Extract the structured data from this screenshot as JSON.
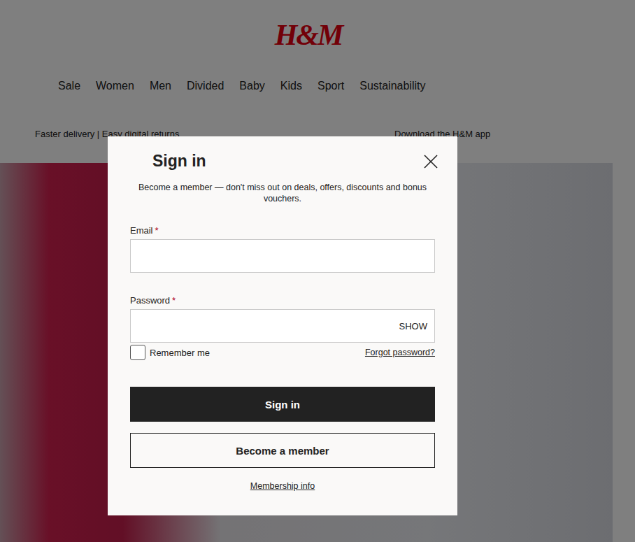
{
  "logo": "H&M",
  "nav": [
    "Sale",
    "Women",
    "Men",
    "Divided",
    "Baby",
    "Kids",
    "Sport",
    "Sustainability"
  ],
  "banner": {
    "left": "Faster delivery | Easy digital returns",
    "right": "Download the H&M app"
  },
  "modal": {
    "title": "Sign in",
    "subtitle": "Become a member — don't miss out on deals, offers, discounts and bonus vouchers.",
    "fields": [
      {
        "label": "Email",
        "required_mark": "*",
        "kind": "email",
        "value": ""
      },
      {
        "label": "Password",
        "required_mark": "*",
        "kind": "password",
        "value": "",
        "toggle": "SHOW"
      }
    ],
    "remember": {
      "label": "Remember me",
      "checked": false
    },
    "forgot": "Forgot password?",
    "buttons": [
      {
        "label": "Sign in",
        "kind": "primary"
      },
      {
        "label": "Become a member",
        "kind": "secondary"
      }
    ],
    "membership_link": "Membership info"
  }
}
